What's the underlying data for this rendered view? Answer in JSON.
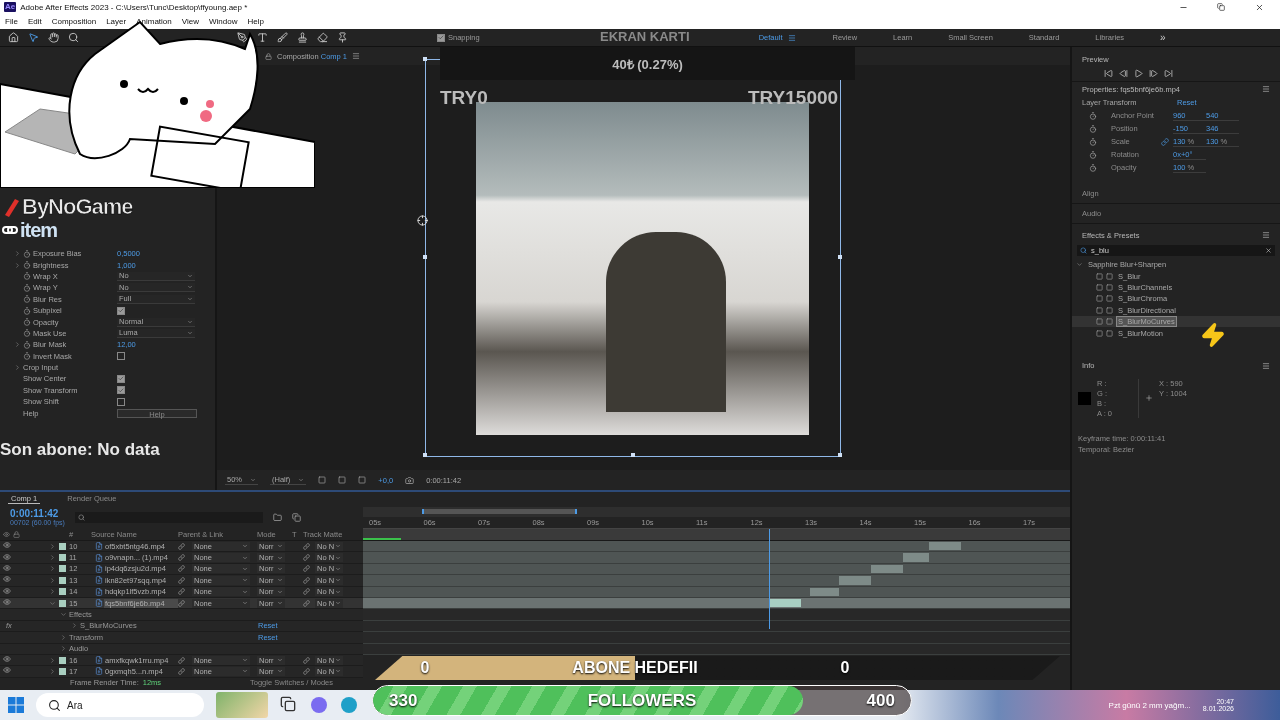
{
  "window": {
    "app_icon": "Ae",
    "title": "Adobe After Effects 2023 - C:\\Users\\Tunc\\Desktop\\ffyoung.aep *"
  },
  "menu": [
    "File",
    "Edit",
    "Composition",
    "Layer",
    "Animation",
    "View",
    "Window",
    "Help"
  ],
  "toolbar": {
    "snapping": {
      "label": "Snapping",
      "checked": true
    },
    "workspaces": [
      {
        "label": "Default",
        "selected": true
      },
      {
        "label": "Review",
        "selected": false
      },
      {
        "label": "Learn",
        "selected": false
      },
      {
        "label": "Small Screen",
        "selected": false
      },
      {
        "label": "Standard",
        "selected": false
      },
      {
        "label": "Libraries",
        "selected": false
      }
    ],
    "more": "»"
  },
  "sponsor_logos": [
    "ByNoGame",
    "item"
  ],
  "effect_controls": [
    {
      "kind": "value",
      "label": "Exposure Bias",
      "value": "0,5000",
      "expandable": true,
      "animatable": true
    },
    {
      "kind": "value",
      "label": "Brightness",
      "value": "1,000",
      "expandable": true,
      "animatable": true
    },
    {
      "kind": "dropdown",
      "label": "Wrap X",
      "value": "No",
      "expandable": false,
      "animatable": true
    },
    {
      "kind": "dropdown",
      "label": "Wrap Y",
      "value": "No",
      "expandable": false,
      "animatable": true
    },
    {
      "kind": "dropdown",
      "label": "Blur Res",
      "value": "Full",
      "expandable": false,
      "animatable": true
    },
    {
      "kind": "checkbox",
      "label": "Subpixel",
      "checked": true,
      "expandable": false,
      "animatable": true
    },
    {
      "kind": "dropdown",
      "label": "Opacity",
      "value": "Normal",
      "expandable": false,
      "animatable": true
    },
    {
      "kind": "dropdown",
      "label": "Mask Use",
      "value": "Luma",
      "expandable": false,
      "animatable": true
    },
    {
      "kind": "value",
      "label": "Blur Mask",
      "value": "12,00",
      "expandable": true,
      "animatable": true
    },
    {
      "kind": "checkbox",
      "label": "Invert Mask",
      "checked": false,
      "expandable": false,
      "animatable": true
    },
    {
      "kind": "group",
      "label": "Crop Input",
      "expandable": true,
      "animatable": false
    },
    {
      "kind": "checkbox",
      "label": "Show Center",
      "checked": true,
      "expandable": false,
      "animatable": false
    },
    {
      "kind": "checkbox",
      "label": "Show Transform",
      "checked": true,
      "expandable": false,
      "animatable": false
    },
    {
      "kind": "checkbox",
      "label": "Show Shift",
      "checked": false,
      "expandable": false,
      "animatable": false
    },
    {
      "kind": "button",
      "label": "Help",
      "button": "Help",
      "expandable": false,
      "animatable": false
    }
  ],
  "last_subscriber": "Son abone: No data",
  "gpu_card": {
    "title": "EKRAN KARTI",
    "value": "40₺ (0.27%)"
  },
  "donation_goal": {
    "start": "TRY0",
    "end": "TRY15000"
  },
  "composition": {
    "tab": "Composition",
    "comp": "Comp 1",
    "zoom": "50%",
    "resolution": "(Half)",
    "exposure": "+0,0",
    "time": "0:00:11:42"
  },
  "preview": {
    "title": "Preview"
  },
  "properties": {
    "title": "Properties: fqs5bnf6je6b.mp4",
    "section": "Layer Transform",
    "reset": "Reset",
    "rows": [
      {
        "label": "Anchor Point",
        "linked": false,
        "values": [
          "960",
          "540"
        ]
      },
      {
        "label": "Position",
        "linked": false,
        "values": [
          "-150",
          "346"
        ]
      },
      {
        "label": "Scale",
        "linked": true,
        "values": [
          "130",
          "130"
        ],
        "unit": "%"
      },
      {
        "label": "Rotation",
        "linked": false,
        "values": [
          "0x+0°"
        ]
      },
      {
        "label": "Opacity",
        "linked": false,
        "values": [
          "100"
        ],
        "unit": "%"
      }
    ]
  },
  "collapsed_panels": [
    "Align",
    "Audio"
  ],
  "effects_presets": {
    "title": "Effects & Presets",
    "search": "s_blu",
    "folder": {
      "label": "Sapphire Blur+Sharpen",
      "expanded": true,
      "children": [
        {
          "label": "S_Blur",
          "selected": false
        },
        {
          "label": "S_BlurChannels",
          "selected": false
        },
        {
          "label": "S_BlurChroma",
          "selected": false
        },
        {
          "label": "S_BlurDirectional",
          "selected": false
        },
        {
          "label": "S_BlurMoCurves",
          "selected": true
        },
        {
          "label": "S_BlurMotion",
          "selected": false
        }
      ]
    }
  },
  "info": {
    "title": "Info",
    "channels": [
      "R :",
      "G :",
      "B :",
      "A : 0"
    ],
    "coords": [
      "X : 590",
      "Y : 1004"
    ],
    "lines": [
      "Keyframe time: 0:00:11:41",
      "Temporal: Bezier"
    ]
  },
  "timeline": {
    "tabs": [
      {
        "label": "Comp 1",
        "selected": true
      },
      {
        "label": "Render Queue",
        "selected": false
      }
    ],
    "timecode": "0:00:11:42",
    "frame": "00702 (60.00 fps)",
    "columns": [
      "#",
      "Source Name",
      "Parent & Link",
      "Mode",
      "T",
      "Track Matte"
    ],
    "layers": [
      {
        "number": "10",
        "name": "of5xbt5ntg46.mp4",
        "parent": "None",
        "mode": "Norr",
        "matte": "No N",
        "visible": true,
        "selected": false,
        "expanded": false
      },
      {
        "number": "11",
        "name": "o9vnapn... (1).mp4",
        "parent": "None",
        "mode": "Norr",
        "matte": "No N",
        "visible": true,
        "selected": false,
        "expanded": false
      },
      {
        "number": "12",
        "name": "ip4dq6zsju2d.mp4",
        "parent": "None",
        "mode": "Norr",
        "matte": "No N",
        "visible": true,
        "selected": false,
        "expanded": false
      },
      {
        "number": "13",
        "name": "ikn82et97sqq.mp4",
        "parent": "None",
        "mode": "Norr",
        "matte": "No N",
        "visible": true,
        "selected": false,
        "expanded": false
      },
      {
        "number": "14",
        "name": "hdqkp1lf5vzb.mp4",
        "parent": "None",
        "mode": "Norr",
        "matte": "No N",
        "visible": true,
        "selected": false,
        "expanded": false
      },
      {
        "number": "15",
        "name": "fqs5bnf6je6b.mp4",
        "parent": "None",
        "mode": "Norr",
        "matte": "No N",
        "visible": true,
        "selected": true,
        "expanded": true,
        "children": [
          {
            "label": "Effects",
            "expanded": true,
            "children": [
              {
                "label": "S_BlurMoCurves",
                "badge": "fx",
                "reset": "Reset",
                "expanded": false
              }
            ]
          },
          {
            "label": "Transform",
            "reset": "Reset",
            "expanded": false
          },
          {
            "label": "Audio",
            "expanded": false
          }
        ]
      },
      {
        "number": "16",
        "name": "amxfkqwk1rru.mp4",
        "parent": "None",
        "mode": "Norr",
        "matte": "No N",
        "visible": true,
        "selected": false,
        "expanded": false
      },
      {
        "number": "17",
        "name": "0gxmqh5...n.mp4",
        "parent": "None",
        "mode": "Norr",
        "matte": "No N",
        "visible": true,
        "selected": false,
        "expanded": false
      }
    ],
    "ruler": [
      "05s",
      "06s",
      "07s",
      "08s",
      "09s",
      "10s",
      "11s",
      "12s",
      "13s",
      "14s",
      "15s",
      "16s",
      "17s"
    ],
    "footer": {
      "label": "Frame Render Time:",
      "value": "12ms",
      "toggle": "Toggle Switches / Modes"
    }
  },
  "subscriber_goal": {
    "current": "0",
    "label": "ABONE HEDEFII",
    "target": "0"
  },
  "followers_goal": {
    "current": "330",
    "label": "FOLLOWERS",
    "target": "400",
    "level": 0.8
  },
  "taskbar": {
    "search": "Ara",
    "weather": "Pzt günü 2 mm yağm...",
    "time": "20:47",
    "date": "8.01.2026"
  }
}
